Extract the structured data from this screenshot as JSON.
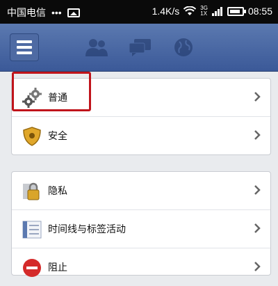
{
  "status_bar": {
    "carrier": "中国电信",
    "dots": "•••",
    "speed": "1.4K/s",
    "network_top": "3G",
    "network_bottom": "1X",
    "time": "08:55"
  },
  "nav": {
    "icons": [
      "menu-icon",
      "friends-icon",
      "messages-icon",
      "globe-icon"
    ]
  },
  "sections": [
    {
      "items": [
        {
          "label": "普通",
          "icon": "gears-icon"
        },
        {
          "label": "安全",
          "icon": "shield-icon"
        }
      ]
    },
    {
      "items": [
        {
          "label": "隐私",
          "icon": "lock-icon"
        },
        {
          "label": "时间线与标签活动",
          "icon": "timeline-icon"
        },
        {
          "label": "阻止",
          "icon": "block-icon"
        }
      ]
    }
  ],
  "colors": {
    "brand": "#3b5998",
    "highlight": "#c0141b"
  }
}
